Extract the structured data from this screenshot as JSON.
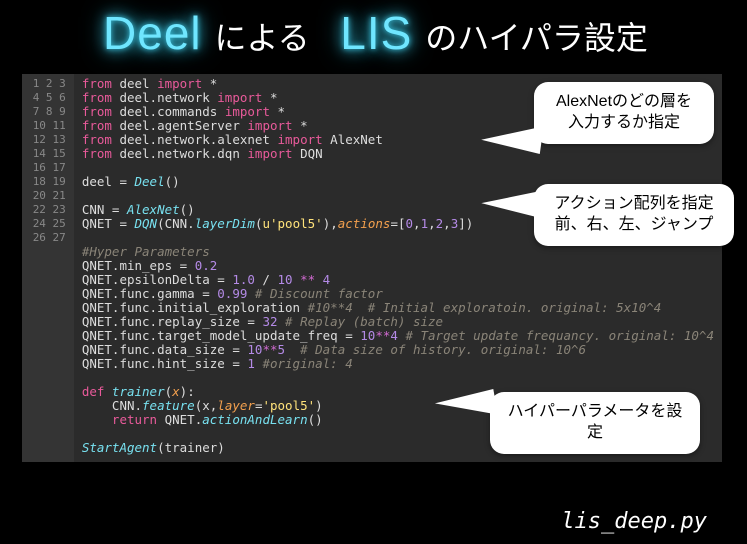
{
  "title": {
    "brand1": "Deel",
    "jp1": "による",
    "brand2": "LIS",
    "jp2": "のハイパラ設定"
  },
  "callouts": {
    "c1_line1": "AlexNetのどの層を",
    "c1_line2": "入力するか指定",
    "c2_line1": "アクション配列を指定",
    "c2_line2": "前、右、左、ジャンプ",
    "c3": "ハイパーパラメータを設定"
  },
  "filename": "lis_deep.py",
  "code": {
    "line_count": 27,
    "l1": {
      "kw1": "from",
      "mod": " deel ",
      "kw2": "import",
      "rest": " *"
    },
    "l2": {
      "kw1": "from",
      "mod": " deel.network ",
      "kw2": "import",
      "rest": " *"
    },
    "l3": {
      "kw1": "from",
      "mod": " deel.commands ",
      "kw2": "import",
      "rest": " *"
    },
    "l4": {
      "kw1": "from",
      "mod": " deel.agentServer ",
      "kw2": "import",
      "rest": " *"
    },
    "l5": {
      "kw1": "from",
      "mod": " deel.network.alexnet ",
      "kw2": "import",
      "rest": " AlexNet"
    },
    "l6": {
      "kw1": "from",
      "mod": " deel.network.dqn ",
      "kw2": "import",
      "rest": " DQN"
    },
    "l8": {
      "a": "deel = ",
      "b": "Deel",
      "c": "()"
    },
    "l10": {
      "a": "CNN = ",
      "b": "AlexNet",
      "c": "()"
    },
    "l11": {
      "a": "QNET = ",
      "b": "DQN",
      "c": "(CNN.",
      "d": "layerDim",
      "e": "(",
      "f": "u'pool5'",
      "g": "),",
      "h": "actions",
      "i": "=[",
      "n0": "0",
      "s": ",",
      "n1": "1",
      "n2": "2",
      "n3": "3",
      "j": "])"
    },
    "l13": {
      "cmt": "#Hyper Parameters"
    },
    "l14": {
      "a": "QNET.min_eps = ",
      "n": "0.2"
    },
    "l15": {
      "a": "QNET.epsilonDelta = ",
      "n1": "1.0",
      "op1": " / ",
      "n2": "10",
      "op2": " ** ",
      "n3": "4"
    },
    "l16": {
      "a": "QNET.func.gamma = ",
      "n": "0.99",
      "cmt": " # Discount factor"
    },
    "l17": {
      "a": "QNET.func.initial_exploration ",
      "cmt": "#10**4  # Initial exploratoin. original: 5x10^4"
    },
    "l18": {
      "a": "QNET.func.replay_size = ",
      "n": "32",
      "cmt": " # Replay (batch) size"
    },
    "l19": {
      "a": "QNET.func.target_model_update_freq = ",
      "n1": "10",
      "op": "**",
      "n2": "4",
      "cmt": " # Target update frequancy. original: 10^4"
    },
    "l20": {
      "a": "QNET.func.data_size = ",
      "n1": "10",
      "op": "**",
      "n2": "5",
      "cmt": "  # Data size of history. original: 10^6"
    },
    "l21": {
      "a": "QNET.func.hint_size = ",
      "n": "1",
      "cmt": " #original: 4"
    },
    "l23": {
      "kw": "def",
      "sp": " ",
      "fn": "trainer",
      "p1": "(",
      "arg": "x",
      "p2": "):"
    },
    "l24": {
      "ind": "    ",
      "a": "CNN.",
      "m": "feature",
      "p1": "(x,",
      "k": "layer",
      "eq": "=",
      "s": "'pool5'",
      "p2": ")"
    },
    "l25": {
      "ind": "    ",
      "kw": "return",
      "a": " QNET.",
      "m": "actionAndLearn",
      "p": "()"
    },
    "l27": {
      "a": "StartAgent",
      "p": "(trainer)"
    }
  }
}
